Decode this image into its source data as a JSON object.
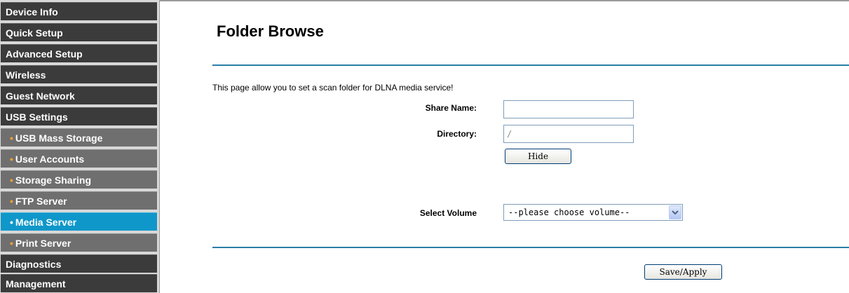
{
  "sidebar": {
    "items": [
      {
        "label": "Device Info",
        "type": "main"
      },
      {
        "label": "Quick Setup",
        "type": "main"
      },
      {
        "label": "Advanced Setup",
        "type": "main"
      },
      {
        "label": "Wireless",
        "type": "main"
      },
      {
        "label": "Guest Network",
        "type": "main"
      },
      {
        "label": "USB Settings",
        "type": "main"
      },
      {
        "label": "USB Mass Storage",
        "type": "sub"
      },
      {
        "label": "User Accounts",
        "type": "sub"
      },
      {
        "label": "Storage Sharing",
        "type": "sub"
      },
      {
        "label": "FTP Server",
        "type": "sub"
      },
      {
        "label": "Media Server",
        "type": "sub",
        "active": true
      },
      {
        "label": "Print Server",
        "type": "sub"
      },
      {
        "label": "Diagnostics",
        "type": "main"
      },
      {
        "label": "Management",
        "type": "main"
      }
    ],
    "bullet": "•",
    "active_color": "#0f97c9"
  },
  "main": {
    "title": "Folder Browse",
    "description": "This page allow you to set a scan folder for DLNA media service!",
    "share_name": {
      "label": "Share Name:",
      "value": ""
    },
    "directory": {
      "label": "Directory:",
      "value": "/"
    },
    "hide_button": "Hide",
    "select_volume": {
      "label": "Select Volume",
      "value": "--please choose volume--"
    },
    "save_button": "Save/Apply"
  },
  "colors": {
    "accent": "#2a7fa6",
    "nav_main": "#3b3b3b",
    "nav_sub": "#6f6f6f"
  },
  "icons": {
    "select_arrow": "chevron-down-icon"
  }
}
